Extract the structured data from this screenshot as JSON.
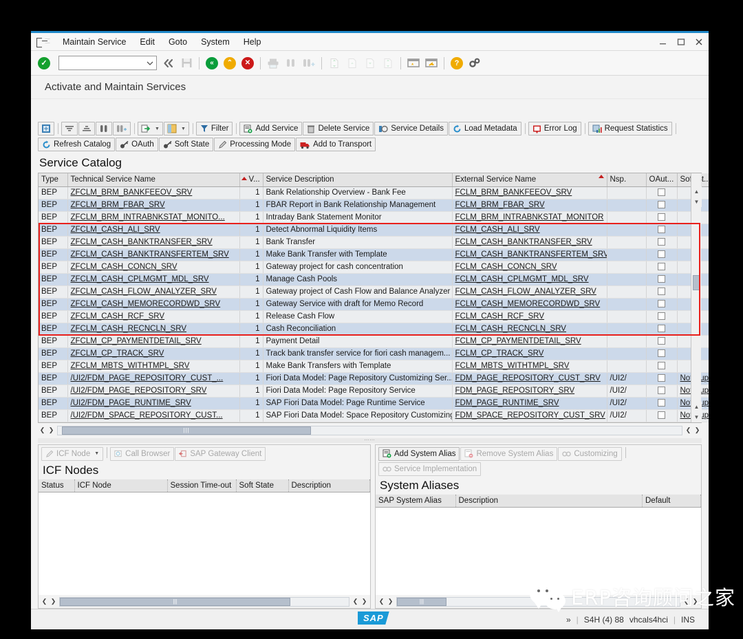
{
  "window": {
    "minimize_label": "—",
    "maximize_label": "❐",
    "close_label": "✕"
  },
  "menubar": {
    "items": [
      {
        "label": "Maintain Service",
        "accel": "M"
      },
      {
        "label": "Edit",
        "accel": "E"
      },
      {
        "label": "Goto",
        "accel": "G"
      },
      {
        "label": "System",
        "accel": "y"
      },
      {
        "label": "Help",
        "accel": "H"
      }
    ]
  },
  "main_toolbar": {
    "command_field_value": "",
    "command_field_placeholder": "",
    "icons": [
      "enter-check-icon",
      "command-dropdown-icon",
      "back-double-icon",
      "save-icon",
      "back-icon",
      "exit-icon",
      "cancel-icon",
      "print-icon",
      "find-icon",
      "find-next-icon",
      "first-page-icon",
      "previous-page-icon",
      "next-page-icon",
      "last-page-icon",
      "create-session-icon",
      "create-shortcut-icon",
      "help-icon",
      "customize-local-layout-icon"
    ]
  },
  "screen": {
    "title": "Activate and Maintain Services"
  },
  "app_toolbar": {
    "row1": [
      {
        "label": "",
        "name": "detail-view-button",
        "icon": "detail-icon"
      },
      {
        "label": "",
        "name": "sort-ascending-button",
        "icon": "sort-asc-icon"
      },
      {
        "label": "",
        "name": "sort-descending-button",
        "icon": "sort-desc-icon"
      },
      {
        "label": "",
        "name": "find-button",
        "icon": "binoculars-icon"
      },
      {
        "label": "",
        "name": "find-next-button",
        "icon": "binoculars-plus-icon"
      },
      {
        "label": "",
        "name": "export-button",
        "icon": "export-icon",
        "caret": true
      },
      {
        "label": "",
        "name": "layout-button",
        "icon": "layout-icon",
        "caret": true
      },
      {
        "label": "Filter",
        "name": "filter-button",
        "icon": "filter-icon"
      },
      {
        "label": "Add Service",
        "name": "add-service-button",
        "icon": "add-service-icon"
      },
      {
        "label": "Delete Service",
        "name": "delete-service-button",
        "icon": "trash-icon"
      },
      {
        "label": "Service Details",
        "name": "service-details-button",
        "icon": "service-details-icon"
      },
      {
        "label": "Load Metadata",
        "name": "load-metadata-button",
        "icon": "refresh-blue-icon"
      },
      {
        "label": "Error Log",
        "name": "error-log-button",
        "icon": "error-log-icon"
      },
      {
        "label": "Request Statistics",
        "name": "request-statistics-button",
        "icon": "statistics-icon"
      }
    ],
    "row2": [
      {
        "label": "Refresh Catalog",
        "name": "refresh-catalog-button",
        "icon": "refresh-blue-icon"
      },
      {
        "label": "OAuth",
        "name": "oauth-button",
        "icon": "key-icon"
      },
      {
        "label": "Soft State",
        "name": "soft-state-button",
        "icon": "key-icon"
      },
      {
        "label": "Processing Mode",
        "name": "processing-mode-button",
        "icon": "pencil-icon"
      },
      {
        "label": "Add to Transport",
        "name": "add-to-transport-button",
        "icon": "truck-icon"
      }
    ]
  },
  "service_catalog": {
    "title": "Service Catalog",
    "columns": [
      "Type",
      "Technical Service Name",
      "V...",
      "Service Description",
      "External Service Name",
      "Nsp.",
      "OAut...",
      "Soft St..."
    ],
    "rows": [
      {
        "type": "BEP",
        "tech": "ZFCLM_BRM_BANKFEEOV_SRV",
        "v": "1",
        "desc": "Bank Relationship Overview - Bank Fee",
        "ext": "FCLM_BRM_BANKFEEOV_SRV",
        "nsp": "",
        "soft": ""
      },
      {
        "type": "BEP",
        "tech": "ZFCLM_BRM_FBAR_SRV",
        "v": "1",
        "desc": "FBAR Report in Bank Relationship Management",
        "ext": "FCLM_BRM_FBAR_SRV",
        "nsp": "",
        "soft": ""
      },
      {
        "type": "BEP",
        "tech": "ZFCLM_BRM_INTRABNKSTAT_MONITO...",
        "v": "1",
        "desc": "Intraday Bank Statement Monitor",
        "ext": "FCLM_BRM_INTRABNKSTAT_MONITOR",
        "nsp": "",
        "soft": ""
      },
      {
        "type": "BEP",
        "tech": "ZFCLM_CASH_ALI_SRV",
        "v": "1",
        "desc": "Detect Abnormal Liquidity Items",
        "ext": "FCLM_CASH_ALI_SRV",
        "nsp": "",
        "soft": ""
      },
      {
        "type": "BEP",
        "tech": "ZFCLM_CASH_BANKTRANSFER_SRV",
        "v": "1",
        "desc": "Bank Transfer",
        "ext": "FCLM_CASH_BANKTRANSFER_SRV",
        "nsp": "",
        "soft": ""
      },
      {
        "type": "BEP",
        "tech": "ZFCLM_CASH_BANKTRANSFERTEM_SRV",
        "v": "1",
        "desc": "Make Bank Transfer with Template",
        "ext": "FCLM_CASH_BANKTRANSFERTEM_SRV",
        "nsp": "",
        "soft": ""
      },
      {
        "type": "BEP",
        "tech": "ZFCLM_CASH_CONCN_SRV",
        "v": "1",
        "desc": "Gateway project for cash concentration",
        "ext": "FCLM_CASH_CONCN_SRV",
        "nsp": "",
        "soft": ""
      },
      {
        "type": "BEP",
        "tech": "ZFCLM_CASH_CPLMGMT_MDL_SRV",
        "v": "1",
        "desc": "Manage Cash Pools",
        "ext": "FCLM_CASH_CPLMGMT_MDL_SRV",
        "nsp": "",
        "soft": ""
      },
      {
        "type": "BEP",
        "tech": "ZFCLM_CASH_FLOW_ANALYZER_SRV",
        "v": "1",
        "desc": "Gateway project of Cash Flow and Balance Analyzer",
        "ext": "FCLM_CASH_FLOW_ANALYZER_SRV",
        "nsp": "",
        "soft": ""
      },
      {
        "type": "BEP",
        "tech": "ZFCLM_CASH_MEMORECORDWD_SRV",
        "v": "1",
        "desc": "Gateway Service with draft for Memo Record",
        "ext": "FCLM_CASH_MEMORECORDWD_SRV",
        "nsp": "",
        "soft": ""
      },
      {
        "type": "BEP",
        "tech": "ZFCLM_CASH_RCF_SRV",
        "v": "1",
        "desc": "Release Cash Flow",
        "ext": "FCLM_CASH_RCF_SRV",
        "nsp": "",
        "soft": ""
      },
      {
        "type": "BEP",
        "tech": "ZFCLM_CASH_RECNCLN_SRV",
        "v": "1",
        "desc": "Cash Reconciliation",
        "ext": "FCLM_CASH_RECNCLN_SRV",
        "nsp": "",
        "soft": ""
      },
      {
        "type": "BEP",
        "tech": "ZFCLM_CP_PAYMENTDETAIL_SRV",
        "v": "1",
        "desc": "Payment Detail",
        "ext": "FCLM_CP_PAYMENTDETAIL_SRV",
        "nsp": "",
        "soft": ""
      },
      {
        "type": "BEP",
        "tech": "ZFCLM_CP_TRACK_SRV",
        "v": "1",
        "desc": "Track bank transfer service for fiori cash managem...",
        "ext": "FCLM_CP_TRACK_SRV",
        "nsp": "",
        "soft": ""
      },
      {
        "type": "BEP",
        "tech": "ZFCLM_MBTS_WITHTMPL_SRV",
        "v": "1",
        "desc": "Make Bank Transfers with Template",
        "ext": "FCLM_MBTS_WITHTMPL_SRV",
        "nsp": "",
        "soft": ""
      },
      {
        "type": "BEP",
        "tech": "/UI2/FDM_PAGE_REPOSITORY_CUST_...",
        "v": "1",
        "desc": "Fiori Data Model: Page Repository Customizing Ser...",
        "ext": "FDM_PAGE_REPOSITORY_CUST_SRV",
        "nsp": "/UI2/",
        "soft": "Not Sup"
      },
      {
        "type": "BEP",
        "tech": "/UI2/FDM_PAGE_REPOSITORY_SRV",
        "v": "1",
        "desc": "Fiori Data Model: Page Repository Service",
        "ext": "FDM_PAGE_REPOSITORY_SRV",
        "nsp": "/UI2/",
        "soft": "Not Sup"
      },
      {
        "type": "BEP",
        "tech": "/UI2/FDM_PAGE_RUNTIME_SRV",
        "v": "1",
        "desc": "SAP Fiori Data Model: Page Runtime Service",
        "ext": "FDM_PAGE_RUNTIME_SRV",
        "nsp": "/UI2/",
        "soft": "Not Sup"
      },
      {
        "type": "BEP",
        "tech": "/UI2/FDM_SPACE_REPOSITORY_CUST...",
        "v": "1",
        "desc": "SAP Fiori Data Model: Space Repository Customizing",
        "ext": "FDM_SPACE_REPOSITORY_CUST_SRV",
        "nsp": "/UI2/",
        "soft": "Not Sup"
      }
    ],
    "highlight_start_row": 4,
    "highlight_end_row": 12
  },
  "icf_panel": {
    "toolbar": [
      {
        "label": "ICF Node",
        "name": "icf-node-button",
        "icon": "pencil-icon",
        "disabled": true,
        "caret": true
      },
      {
        "label": "Call Browser",
        "name": "call-browser-button",
        "icon": "browser-icon",
        "disabled": true
      },
      {
        "label": "SAP Gateway Client",
        "name": "sap-gateway-client-button",
        "icon": "gateway-client-icon",
        "disabled": true
      }
    ],
    "title": "ICF Nodes",
    "columns": [
      "Status",
      "ICF Node",
      "Session Time-out",
      "Soft State",
      "Description"
    ],
    "rows": []
  },
  "alias_panel": {
    "toolbar_row1": [
      {
        "label": "Add System Alias",
        "name": "add-system-alias-button",
        "icon": "add-alias-icon",
        "disabled": false
      },
      {
        "label": "Remove System Alias",
        "name": "remove-system-alias-button",
        "icon": "remove-alias-icon",
        "disabled": true
      },
      {
        "label": "Customizing",
        "name": "customizing-button",
        "icon": "binoculars-icon",
        "disabled": true
      }
    ],
    "toolbar_row2": [
      {
        "label": "Service Implementation",
        "name": "service-implementation-button",
        "icon": "binoculars-icon",
        "disabled": true
      }
    ],
    "title": "System Aliases",
    "columns": [
      "SAP System Alias",
      "Description",
      "Default"
    ],
    "rows": []
  },
  "statusbar": {
    "logo": "SAP",
    "chevron": "»",
    "system": "S4H (4) 88",
    "host": "vhcals4hci",
    "extra": "INS"
  },
  "watermark": {
    "text": "ERP咨询顾问之家"
  },
  "colors": {
    "accent_blue": "#1f88c9",
    "highlight_red": "#e8201c",
    "row_even": "#ccd9ea",
    "row_odd": "#eceef0",
    "sap_logo_blue": "#1a9ad7"
  }
}
